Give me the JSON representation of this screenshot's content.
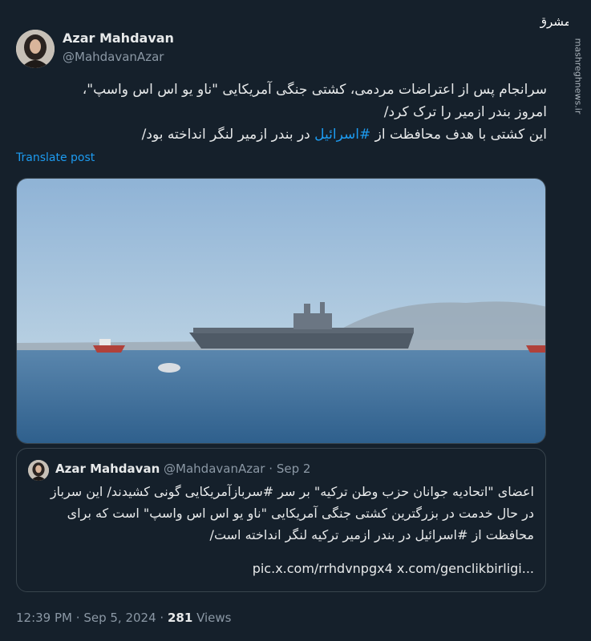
{
  "author": {
    "name": "Azar Mahdavan",
    "handle": "@MahdavanAzar"
  },
  "watermark": {
    "logo_text": "مشرق",
    "site": "mashreghnews.ir"
  },
  "tweet": {
    "line1": "سرانجام پس از اعتراضات مردمی، کشتی جنگی آمریکایی \"ناو یو اس اس واسپ\"،",
    "line2": "امروز بندر ازمیر را ترک کرد/",
    "line3_before": "این کشتی با هدف محافظت از ",
    "line3_hashtag": "#اسرائیل",
    "line3_after": " در بندر ازمیر لنگر انداخته بود/",
    "translate_label": "Translate post"
  },
  "quoted": {
    "name": "Azar Mahdavan",
    "handle": "@MahdavanAzar",
    "separator": "·",
    "date": "Sep 2",
    "line1": "اعضای \"اتحادیه جوانان  حزب وطن ترکیه\" بر سر #سربازآمریکایی گونی کشیدند/ این سرباز",
    "line2": "در حال خدمت در بزرگترین کشتی جنگی آمریکایی \"ناو یو اس اس واسپ\" است که برای",
    "line3": "محافظت از #اسرائیل در بندر ازمیر ترکیه لنگر انداخته است/",
    "links": "pic.x.com/rrhdvnpgx4 x.com/genclikbirligi..."
  },
  "meta": {
    "time": "12:39 PM",
    "separator": "·",
    "date": "Sep 5, 2024",
    "views_count": "281",
    "views_label": "Views"
  },
  "colors": {
    "background": "#15202b",
    "accent": "#1d9bf0",
    "secondary_text": "#8b98a5",
    "border": "#38444d"
  }
}
